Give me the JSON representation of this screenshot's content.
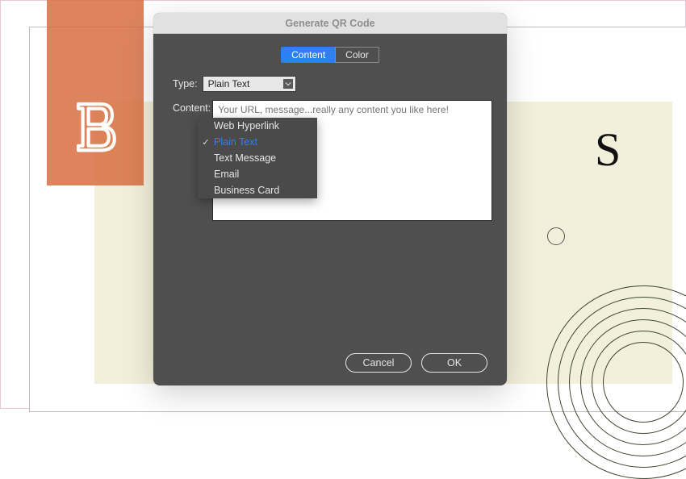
{
  "dialog": {
    "title": "Generate QR Code",
    "tabs": {
      "content": "Content",
      "color": "Color"
    },
    "type_label": "Type:",
    "type_value": "Plain Text",
    "dropdown": {
      "options": {
        "0": "Web Hyperlink",
        "1": "Plain Text",
        "2": "Text Message",
        "3": "Email",
        "4": "Business Card"
      },
      "selected_index": 1
    },
    "content_label": "Content:",
    "content_placeholder": "Your URL, message...really any content you like here!",
    "buttons": {
      "cancel": "Cancel",
      "ok": "OK"
    }
  },
  "background": {
    "letter": "S"
  }
}
